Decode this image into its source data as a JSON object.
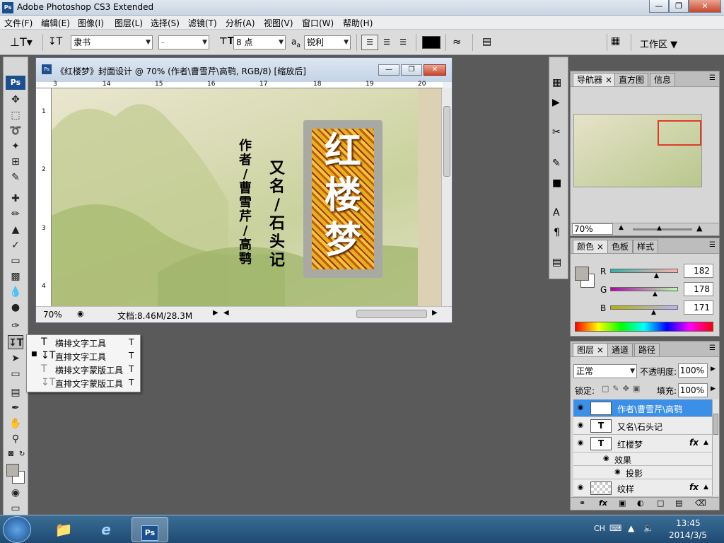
{
  "window": {
    "title": "Adobe Photoshop CS3 Extended",
    "app_icon": "Ps"
  },
  "menu": [
    "文件(F)",
    "编辑(E)",
    "图像(I)",
    "图层(L)",
    "选择(S)",
    "滤镜(T)",
    "分析(A)",
    "视图(V)",
    "窗口(W)",
    "帮助(H)"
  ],
  "options": {
    "font_family": "隶书",
    "font_style": "-",
    "font_size": "8 点",
    "aa_label": "a",
    "aa_sub": "a",
    "antialias": "锐利",
    "workspace": "工作区"
  },
  "flyout": {
    "items": [
      {
        "label": "横排文字工具",
        "key": "T",
        "selected": false
      },
      {
        "label": "直排文字工具",
        "key": "T",
        "selected": true
      },
      {
        "label": "横排文字蒙版工具",
        "key": "T",
        "selected": false
      },
      {
        "label": "直排文字蒙版工具",
        "key": "T",
        "selected": false
      }
    ]
  },
  "document": {
    "title": "《红楼梦》封面设计 @ 70% (作者\\曹雪芹\\高鹗, RGB/8) [缩放后]",
    "ruler_top": [
      "3",
      "14",
      "15",
      "16",
      "17",
      "18",
      "19",
      "20"
    ],
    "ruler_left": [
      "1",
      "2",
      "3",
      "4"
    ],
    "zoom": "70%",
    "doc_info": "文档:8.46M/28.3M",
    "canvas": {
      "author_column": [
        "作",
        "者",
        "/",
        "曹",
        "雪",
        "芹",
        "/",
        "高",
        "鹗"
      ],
      "alias_column": [
        "又",
        "名",
        "/",
        "石",
        "头",
        "记"
      ],
      "title_chars": [
        "红",
        "楼",
        "梦"
      ]
    }
  },
  "navigator": {
    "tabs": [
      "导航器",
      "直方图",
      "信息"
    ],
    "zoom": "70%"
  },
  "color": {
    "tabs": [
      "颜色",
      "色板",
      "样式"
    ],
    "channels": [
      {
        "label": "R",
        "value": "182"
      },
      {
        "label": "G",
        "value": "178"
      },
      {
        "label": "B",
        "value": "171"
      }
    ],
    "swatch": "#b6b2ab"
  },
  "layers": {
    "tabs": [
      "图层",
      "通道",
      "路径"
    ],
    "blend_mode": "正常",
    "opacity_label": "不透明度:",
    "opacity": "100%",
    "lock_label": "锁定:",
    "fill_label": "填充:",
    "fill": "100%",
    "rows": [
      {
        "name": "作者\\曹雪芹\\高鹗",
        "thumb": "T",
        "fx": false,
        "selected": true
      },
      {
        "name": "又名\\石头记",
        "thumb": "T",
        "fx": false,
        "selected": false
      },
      {
        "name": "红楼梦",
        "thumb": "T",
        "fx": true,
        "selected": false
      },
      {
        "name": "纹样",
        "thumb": "",
        "fx": true,
        "selected": false
      }
    ],
    "effects_label": "效果",
    "shadow_label": "投影",
    "fx_label": "fx"
  },
  "taskbar": {
    "lang": "CH",
    "time": "13:45",
    "date": "2014/3/5"
  }
}
